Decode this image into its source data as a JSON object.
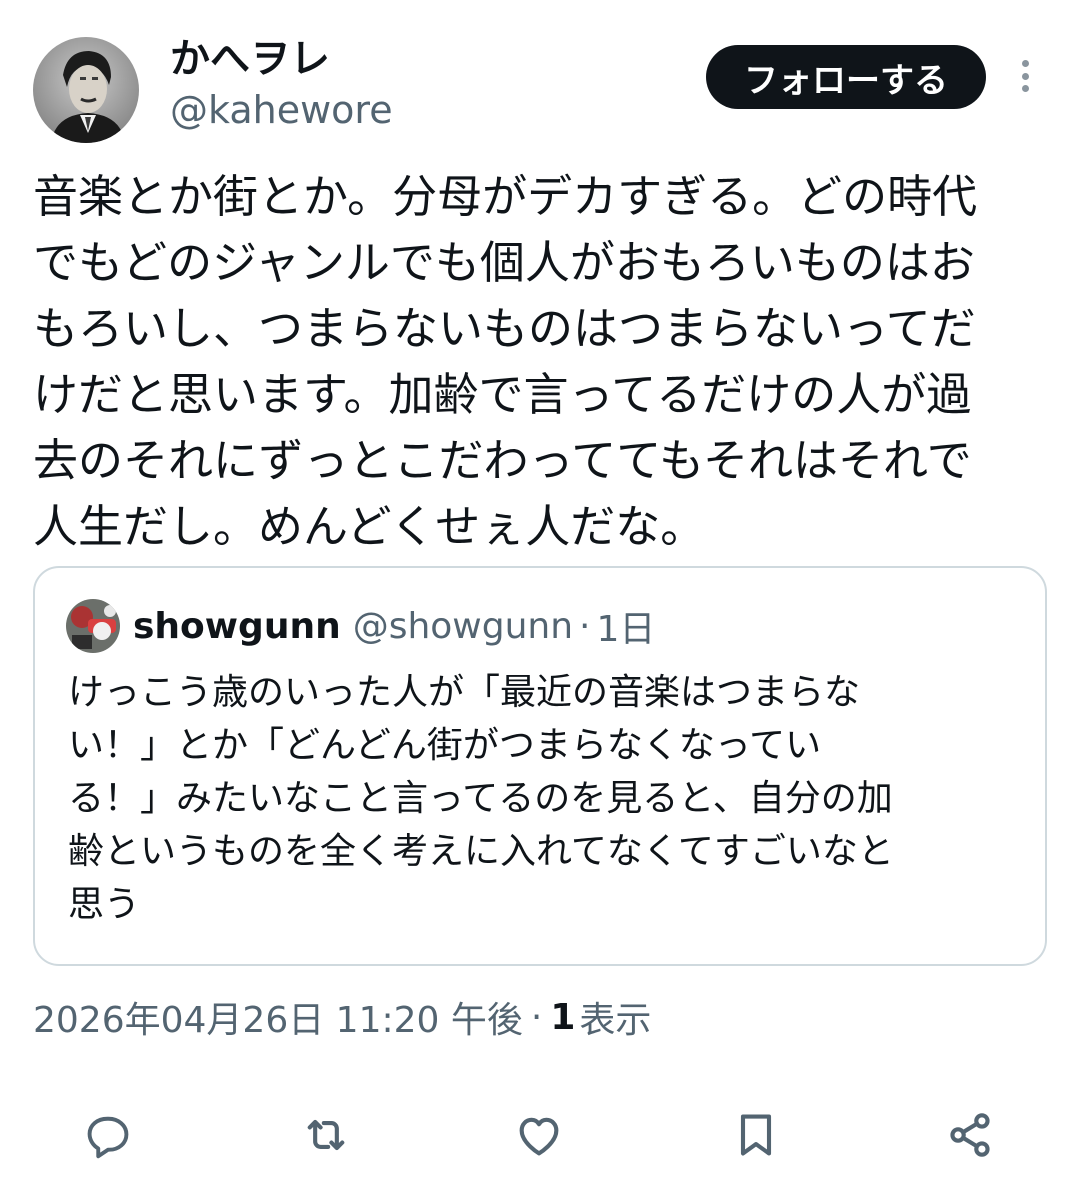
{
  "author": {
    "display_name": "かへヲレ",
    "handle": "@kahewore"
  },
  "follow_label": "フォローする",
  "tweet_text": "音楽とか街とか。分母がデカすぎる。どの時代\nでもどのジャンルでも個人がおもろいものはお\nもろいし、つまらないものはつまらないってだ\nけだと思います。加齢で言ってるだけの人が過\n去のそれにずっとこだわっててもそれはそれで\n人生だし。めんどくせぇ人だな。",
  "quote": {
    "display_name": "showgunn",
    "handle": "@showgunn",
    "separator": "·",
    "time": "1日",
    "text": "けっこう歳のいった人が「最近の音楽はつまらな\nい！」とか「どんどん街がつまらなくなってい\nる！」みたいなこと言ってるのを見ると、自分の加\n齢というものを全く考えに入れてなくてすごいなと\n思う"
  },
  "meta": {
    "timestamp": "2026年04月26日 11:20 午後",
    "separator": "·",
    "views_count": "1",
    "views_label": "表示"
  },
  "icons": {
    "reply": "reply-icon",
    "retweet": "retweet-icon",
    "like": "like-icon",
    "bookmark": "bookmark-icon",
    "share": "share-icon",
    "more": "more-icon"
  },
  "colors": {
    "primary_text": "#0f1419",
    "secondary_text": "#536471",
    "border": "#cfd9de",
    "icon_gray": "#536471",
    "follow_bg": "#0f1419"
  }
}
